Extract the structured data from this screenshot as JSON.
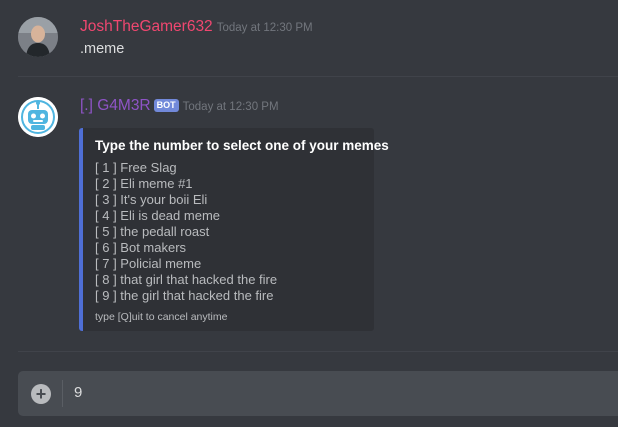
{
  "messages": [
    {
      "username": "JoshTheGamer632",
      "username_color": "#f04770",
      "timestamp": "Today at 12:30 PM",
      "text": ".meme",
      "avatar_icon": "user-photo"
    },
    {
      "username": "[.] G4M3R",
      "username_color": "#8e54c6",
      "bot_tag": "BOT",
      "timestamp": "Today at 12:30 PM",
      "avatar_icon": "robot-icon"
    }
  ],
  "embed": {
    "accent_color": "#4f6fd6",
    "title": "Type the number to select one of your memes",
    "items": [
      "[ 1 ] Free Slag",
      "[ 2 ] Eli meme #1",
      "[ 3 ] It's your boii Eli",
      "[ 4 ] Eli is dead meme",
      "[ 5 ] the pedall roast",
      "[ 6 ] Bot makers",
      "[ 7 ] Policial meme",
      "[ 8 ] that girl that hacked the fire",
      "[ 9 ] the girl that hacked the fire"
    ],
    "footer": "type [Q]uit to cancel anytime"
  },
  "chat_input": {
    "value": "9",
    "attach_icon": "plus-circle-icon"
  }
}
